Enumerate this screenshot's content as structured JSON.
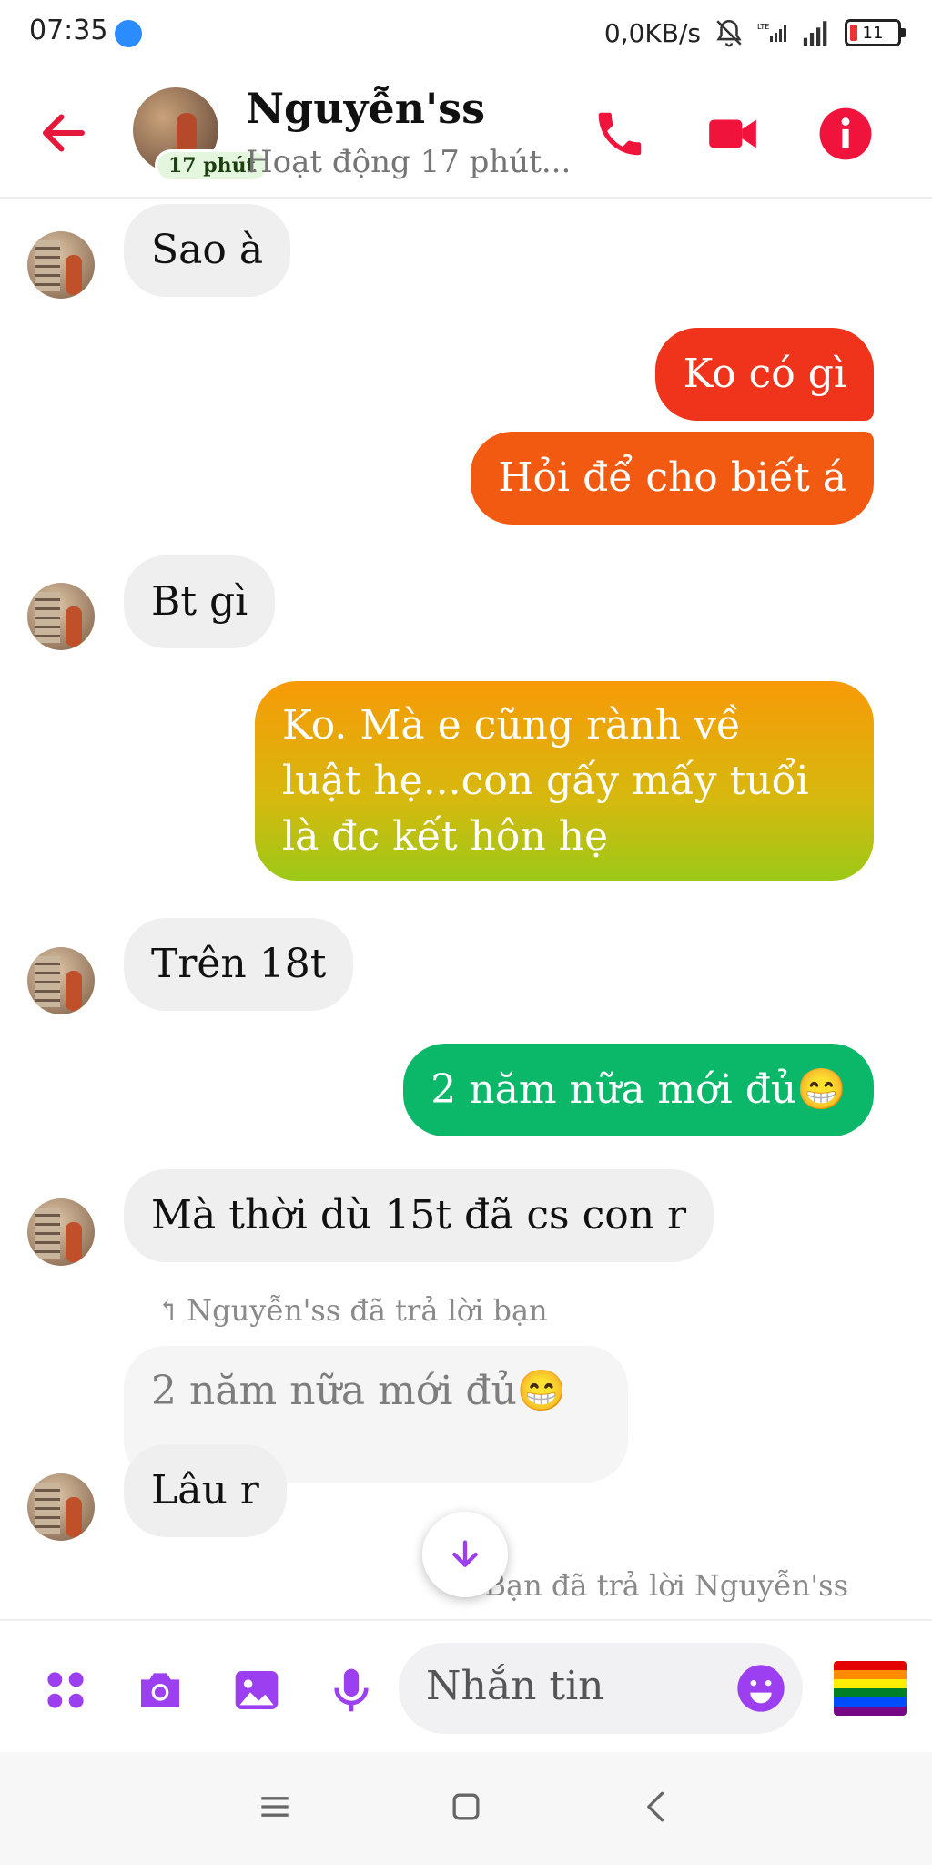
{
  "status_bar": {
    "time": "07:35",
    "speed": "0,0KB/s",
    "battery": "11",
    "icons": [
      "messenger-icon",
      "mute-icon",
      "lte-signal-icon",
      "signal-icon",
      "battery-icon"
    ]
  },
  "header": {
    "name": "Nguyễn'ss",
    "active_badge": "17 phút",
    "status": "Hoạt động 17 phút...",
    "icons": [
      "back-arrow-icon",
      "phone-icon",
      "video-icon",
      "info-icon"
    ],
    "accent_color": "#f0143c"
  },
  "messages": [
    {
      "side": "received",
      "text": "Sao à"
    },
    {
      "side": "sent",
      "text": "Ko có gì"
    },
    {
      "side": "sent",
      "text": "Hỏi để cho biết á"
    },
    {
      "side": "received",
      "text": "Bt gì"
    },
    {
      "side": "sent",
      "lines": [
        "Ko. Mà e cũng rành về",
        "luật hẹ...con  gấy mấy tuổi",
        "là đc kết hôn hẹ"
      ]
    },
    {
      "side": "received",
      "text": "Trên 18t"
    },
    {
      "side": "sent",
      "text": "2 năm nữa mới đủ😁"
    },
    {
      "side": "received",
      "text": "Mà thời dù 15t đã cs con r"
    },
    {
      "side": "received",
      "reply_label": "Nguyễn'ss đã trả lời bạn",
      "quoted": "2 năm nữa mới đủ😁",
      "text": "Lâu r"
    },
    {
      "side": "sent",
      "reply_label": "Bạn đã trả lời Nguyễn'ss"
    }
  ],
  "composer": {
    "placeholder": "Nhắn tin",
    "icons": [
      "apps-icon",
      "camera-icon",
      "gallery-icon",
      "mic-icon",
      "emoji-icon",
      "rainbow-flag-icon"
    ],
    "accent_color": "#9b3ff0"
  },
  "nav": {
    "icons": [
      "menu-icon",
      "home-icon",
      "back-icon"
    ]
  }
}
